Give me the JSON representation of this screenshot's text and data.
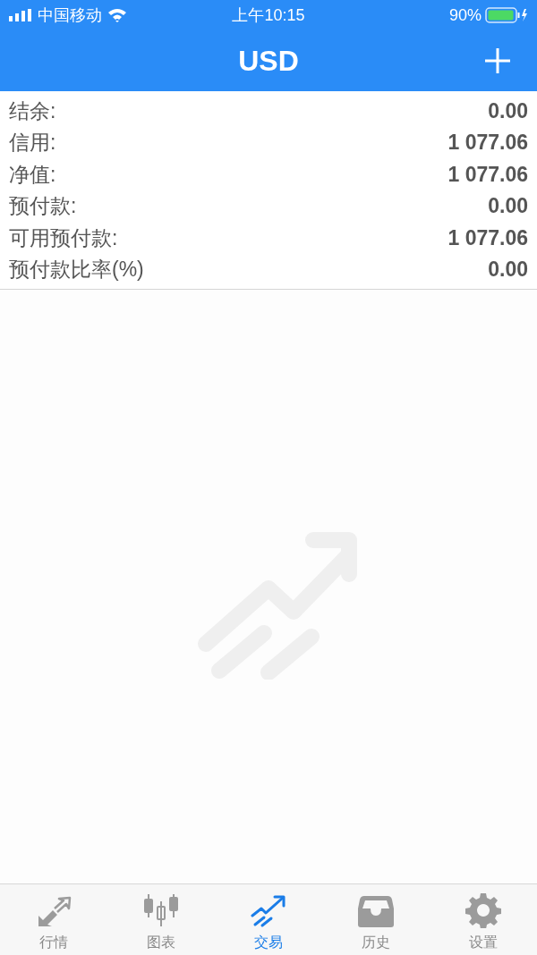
{
  "status_bar": {
    "carrier": "中国移动",
    "time": "上午10:15",
    "battery": "90%"
  },
  "header": {
    "title": "USD"
  },
  "summary": [
    {
      "label": "结余:",
      "value": "0.00"
    },
    {
      "label": "信用:",
      "value": "1 077.06"
    },
    {
      "label": "净值:",
      "value": "1 077.06"
    },
    {
      "label": "预付款:",
      "value": "0.00"
    },
    {
      "label": "可用预付款:",
      "value": "1 077.06"
    },
    {
      "label": "预付款比率(%)",
      "value": "0.00"
    }
  ],
  "tab_bar": [
    {
      "kind": "quotes",
      "label": "行情",
      "selected": false
    },
    {
      "kind": "chart",
      "label": "图表",
      "selected": false
    },
    {
      "kind": "trade",
      "label": "交易",
      "selected": true
    },
    {
      "kind": "history",
      "label": "历史",
      "selected": false
    },
    {
      "kind": "settings",
      "label": "设置",
      "selected": false
    }
  ]
}
